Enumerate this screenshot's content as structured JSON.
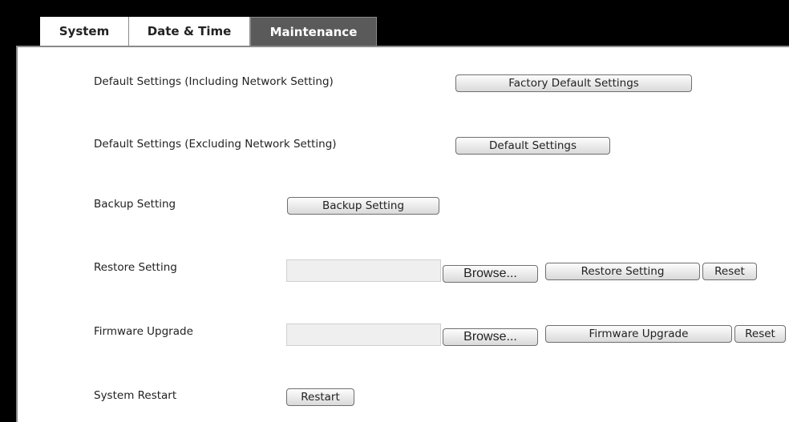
{
  "tabs": [
    {
      "label": "System"
    },
    {
      "label": "Date & Time"
    },
    {
      "label": "Maintenance"
    }
  ],
  "rows": {
    "factory": {
      "label": "Default Settings (Including Network Setting)",
      "button": "Factory Default Settings"
    },
    "default": {
      "label": "Default Settings (Excluding Network Setting)",
      "button": "Default Settings"
    },
    "backup": {
      "label": "Backup Setting",
      "button": "Backup Setting"
    },
    "restore": {
      "label": "Restore Setting",
      "file_value": "",
      "browse": "Browse...",
      "button": "Restore Setting",
      "reset": "Reset"
    },
    "firmware": {
      "label": "Firmware Upgrade",
      "file_value": "",
      "browse": "Browse...",
      "button": "Firmware Upgrade",
      "reset": "Reset"
    },
    "restart": {
      "label": "System Restart",
      "button": "Restart"
    }
  }
}
